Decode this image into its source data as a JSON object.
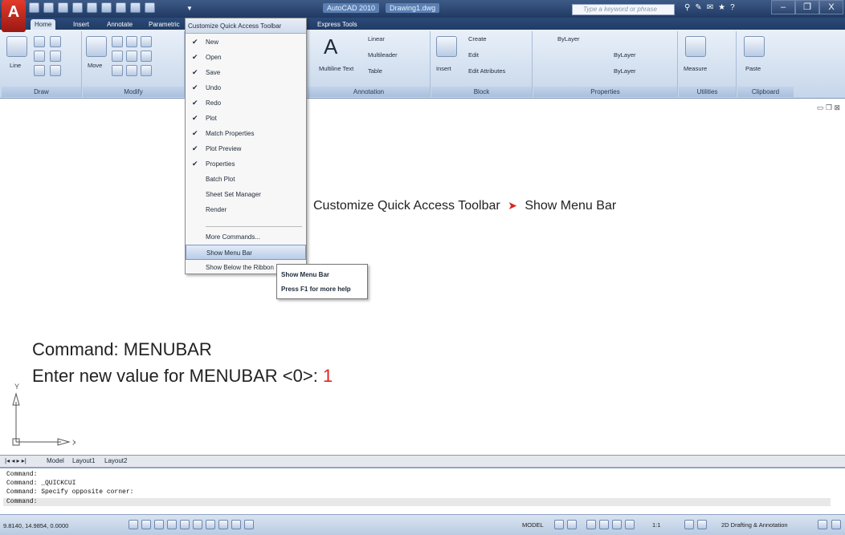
{
  "app": {
    "logo_letter": "A",
    "title": "AutoCAD 2010",
    "drawing_name": "Drawing1.dwg",
    "search_placeholder": "Type a keyword or phrase",
    "window_controls": [
      "–",
      "❐",
      "X"
    ]
  },
  "tabs": [
    "Home",
    "Insert",
    "Annotate",
    "Parametric",
    "Express Tools"
  ],
  "ribbon": {
    "draw": {
      "title": "Draw",
      "line": "Line"
    },
    "modify": {
      "title": "Modify",
      "move": "Move"
    },
    "annotation": {
      "title": "Annotation",
      "multiline_text": "Multiline Text",
      "linear": "Linear",
      "multileader": "Multileader",
      "table": "Table"
    },
    "block": {
      "title": "Block",
      "insert": "Insert",
      "create": "Create",
      "edit": "Edit",
      "edit_attributes": "Edit Attributes"
    },
    "properties": {
      "title": "Properties",
      "color": "ByLayer",
      "linetype": "ByLayer",
      "lineweight": "ByLayer"
    },
    "utilities": {
      "title": "Utilities",
      "measure": "Measure"
    },
    "clipboard": {
      "title": "Clipboard",
      "paste": "Paste"
    }
  },
  "qat_menu": {
    "header": "Customize Quick Access Toolbar",
    "items": [
      {
        "label": "New",
        "checked": true
      },
      {
        "label": "Open",
        "checked": true
      },
      {
        "label": "Save",
        "checked": true
      },
      {
        "label": "Undo",
        "checked": true
      },
      {
        "label": "Redo",
        "checked": true
      },
      {
        "label": "Plot",
        "checked": true
      },
      {
        "label": "Match Properties",
        "checked": true
      },
      {
        "label": "Plot Preview",
        "checked": true
      },
      {
        "label": "Properties",
        "checked": true
      },
      {
        "label": "Batch Plot",
        "checked": false
      },
      {
        "label": "Sheet Set Manager",
        "checked": false
      },
      {
        "label": "Render",
        "checked": false
      },
      {
        "label": "More Commands...",
        "checked": false
      },
      {
        "label": "Show Menu Bar",
        "checked": false
      },
      {
        "label": "Show Below the Ribbon",
        "checked": false
      }
    ]
  },
  "tooltip": {
    "title": "Show Menu Bar",
    "help": "Press F1 for more help"
  },
  "annotation": {
    "left": "Customize Quick Access Toolbar",
    "right": "Show Menu Bar"
  },
  "command_overlay": {
    "line1": "Command:  MENUBAR",
    "line2_prefix": "Enter new value for MENUBAR <0>: ",
    "line2_value": "1"
  },
  "ucs": {
    "x": "X",
    "y": "Y"
  },
  "layout_tabs": [
    "Model",
    "Layout1",
    "Layout2"
  ],
  "command_window": [
    "Command:",
    "Command:  _QUICKCUI",
    "Command:  Specify opposite corner:",
    "Command:"
  ],
  "status": {
    "coords": "9.8140, 14.9854, 0.0000",
    "model": "MODEL",
    "scale": "1:1",
    "workspace": "2D Drafting & Annotation"
  },
  "colors": {
    "accent": "#e02222",
    "titlebar": "#203a63"
  }
}
